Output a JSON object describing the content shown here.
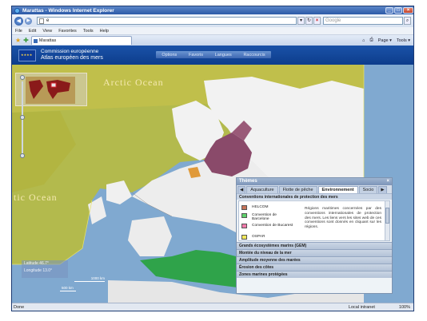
{
  "browser": {
    "title": "Marattas - Windows Internet Explorer",
    "address_prefix": "e",
    "search_placeholder": "Google",
    "menu": [
      "File",
      "Edit",
      "View",
      "Favorites",
      "Tools",
      "Help"
    ],
    "tab_title": "Marattas",
    "tools": [
      "Page ▾",
      "Tools ▾"
    ],
    "status_left": "Done",
    "status_zone": "Local intranet",
    "status_zoom": "100%"
  },
  "app": {
    "brand_line1": "Commission européenne",
    "brand_line2": "Atlas européen des mers",
    "menu": [
      "Options",
      "Favoris",
      "Langues",
      "Raccourcis"
    ]
  },
  "map": {
    "labels": [
      "Arctic Ocean",
      "tic Ocean"
    ],
    "coords_lat": "Latitude   46.7°",
    "coords_lon": "Longitude   13.0°",
    "scale1": "1000 km",
    "scale2": "500 km"
  },
  "themes": {
    "title": "Thèmes",
    "tabs": [
      "Aquaculture",
      "Flotte de pêche",
      "Environnement",
      "Socio"
    ],
    "active_tab": "Environnement",
    "section": "Conventions internationales de protection des mers",
    "conventions": [
      {
        "label": "HELCOM",
        "color": "#c7745a"
      },
      {
        "label": "Convention de Barcelone",
        "color": "#5fd16c"
      },
      {
        "label": "Convention de Bucarest",
        "color": "#f07aaa"
      },
      {
        "label": "OSPAR",
        "color": "#f2e85a"
      }
    ],
    "description": "Régions maritimes concernées par des conventions internationales de protection des mers. Les liens vers les sites web de ces conventions sont donnés en cliquant sur les régions.",
    "accordion": [
      "Grands écosystèmes marins (GEM)",
      "Montée du niveau de la mer",
      "Amplitude moyenne des marées",
      "Érosion des côtes",
      "Zones marines protégées"
    ]
  },
  "colors": {
    "ospar": "#c9c23a",
    "helcom": "#8a4a6a",
    "barcelona": "#2fa34a",
    "land": "#f2f2f2",
    "sea": "#7fa8cf"
  }
}
